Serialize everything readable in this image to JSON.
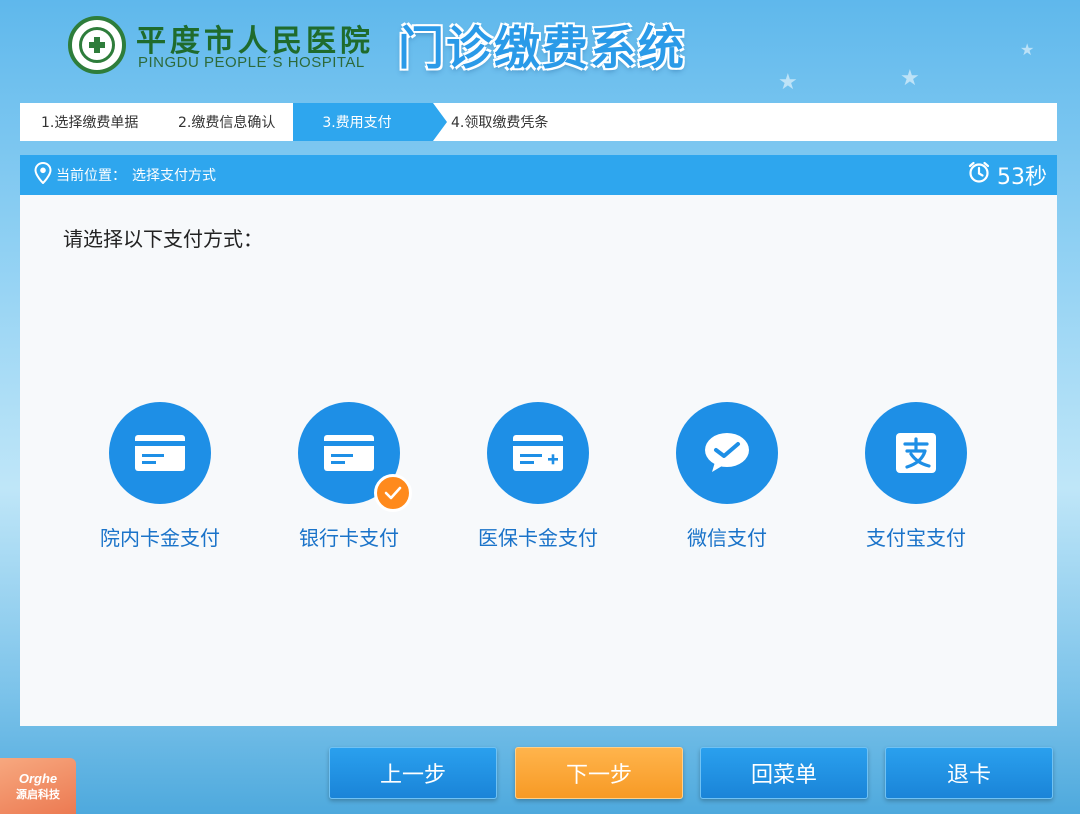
{
  "header": {
    "hospital_name_cn": "平度市人民医院",
    "hospital_name_en": "PINGDU PEOPLE´S HOSPITAL",
    "system_title": "门诊缴费系统"
  },
  "steps": [
    {
      "label": "1.选择缴费单据",
      "active": false
    },
    {
      "label": "2.缴费信息确认",
      "active": false
    },
    {
      "label": "3.费用支付",
      "active": true
    },
    {
      "label": "4.领取缴费凭条",
      "active": false
    }
  ],
  "panel": {
    "location_label": "当前位置：",
    "location_value": "选择支付方式",
    "countdown": "53秒",
    "prompt": "请选择以下支付方式："
  },
  "payment_methods": [
    {
      "label": "院内卡金支付",
      "icon": "card-icon",
      "selected": false
    },
    {
      "label": "银行卡支付",
      "icon": "card-icon",
      "selected": true
    },
    {
      "label": "医保卡金支付",
      "icon": "card-plus-icon",
      "selected": false
    },
    {
      "label": "微信支付",
      "icon": "wechat-icon",
      "selected": false
    },
    {
      "label": "支付宝支付",
      "icon": "alipay-icon",
      "selected": false
    }
  ],
  "buttons": {
    "prev": "上一步",
    "next": "下一步",
    "menu": "回菜单",
    "eject": "退卡"
  },
  "brand": {
    "name_en": "Orghe",
    "name_cn": "源启科技"
  },
  "colors": {
    "primary": "#2ea6ee",
    "accent": "#f79a25",
    "hospital_green": "#2e7d3b"
  }
}
